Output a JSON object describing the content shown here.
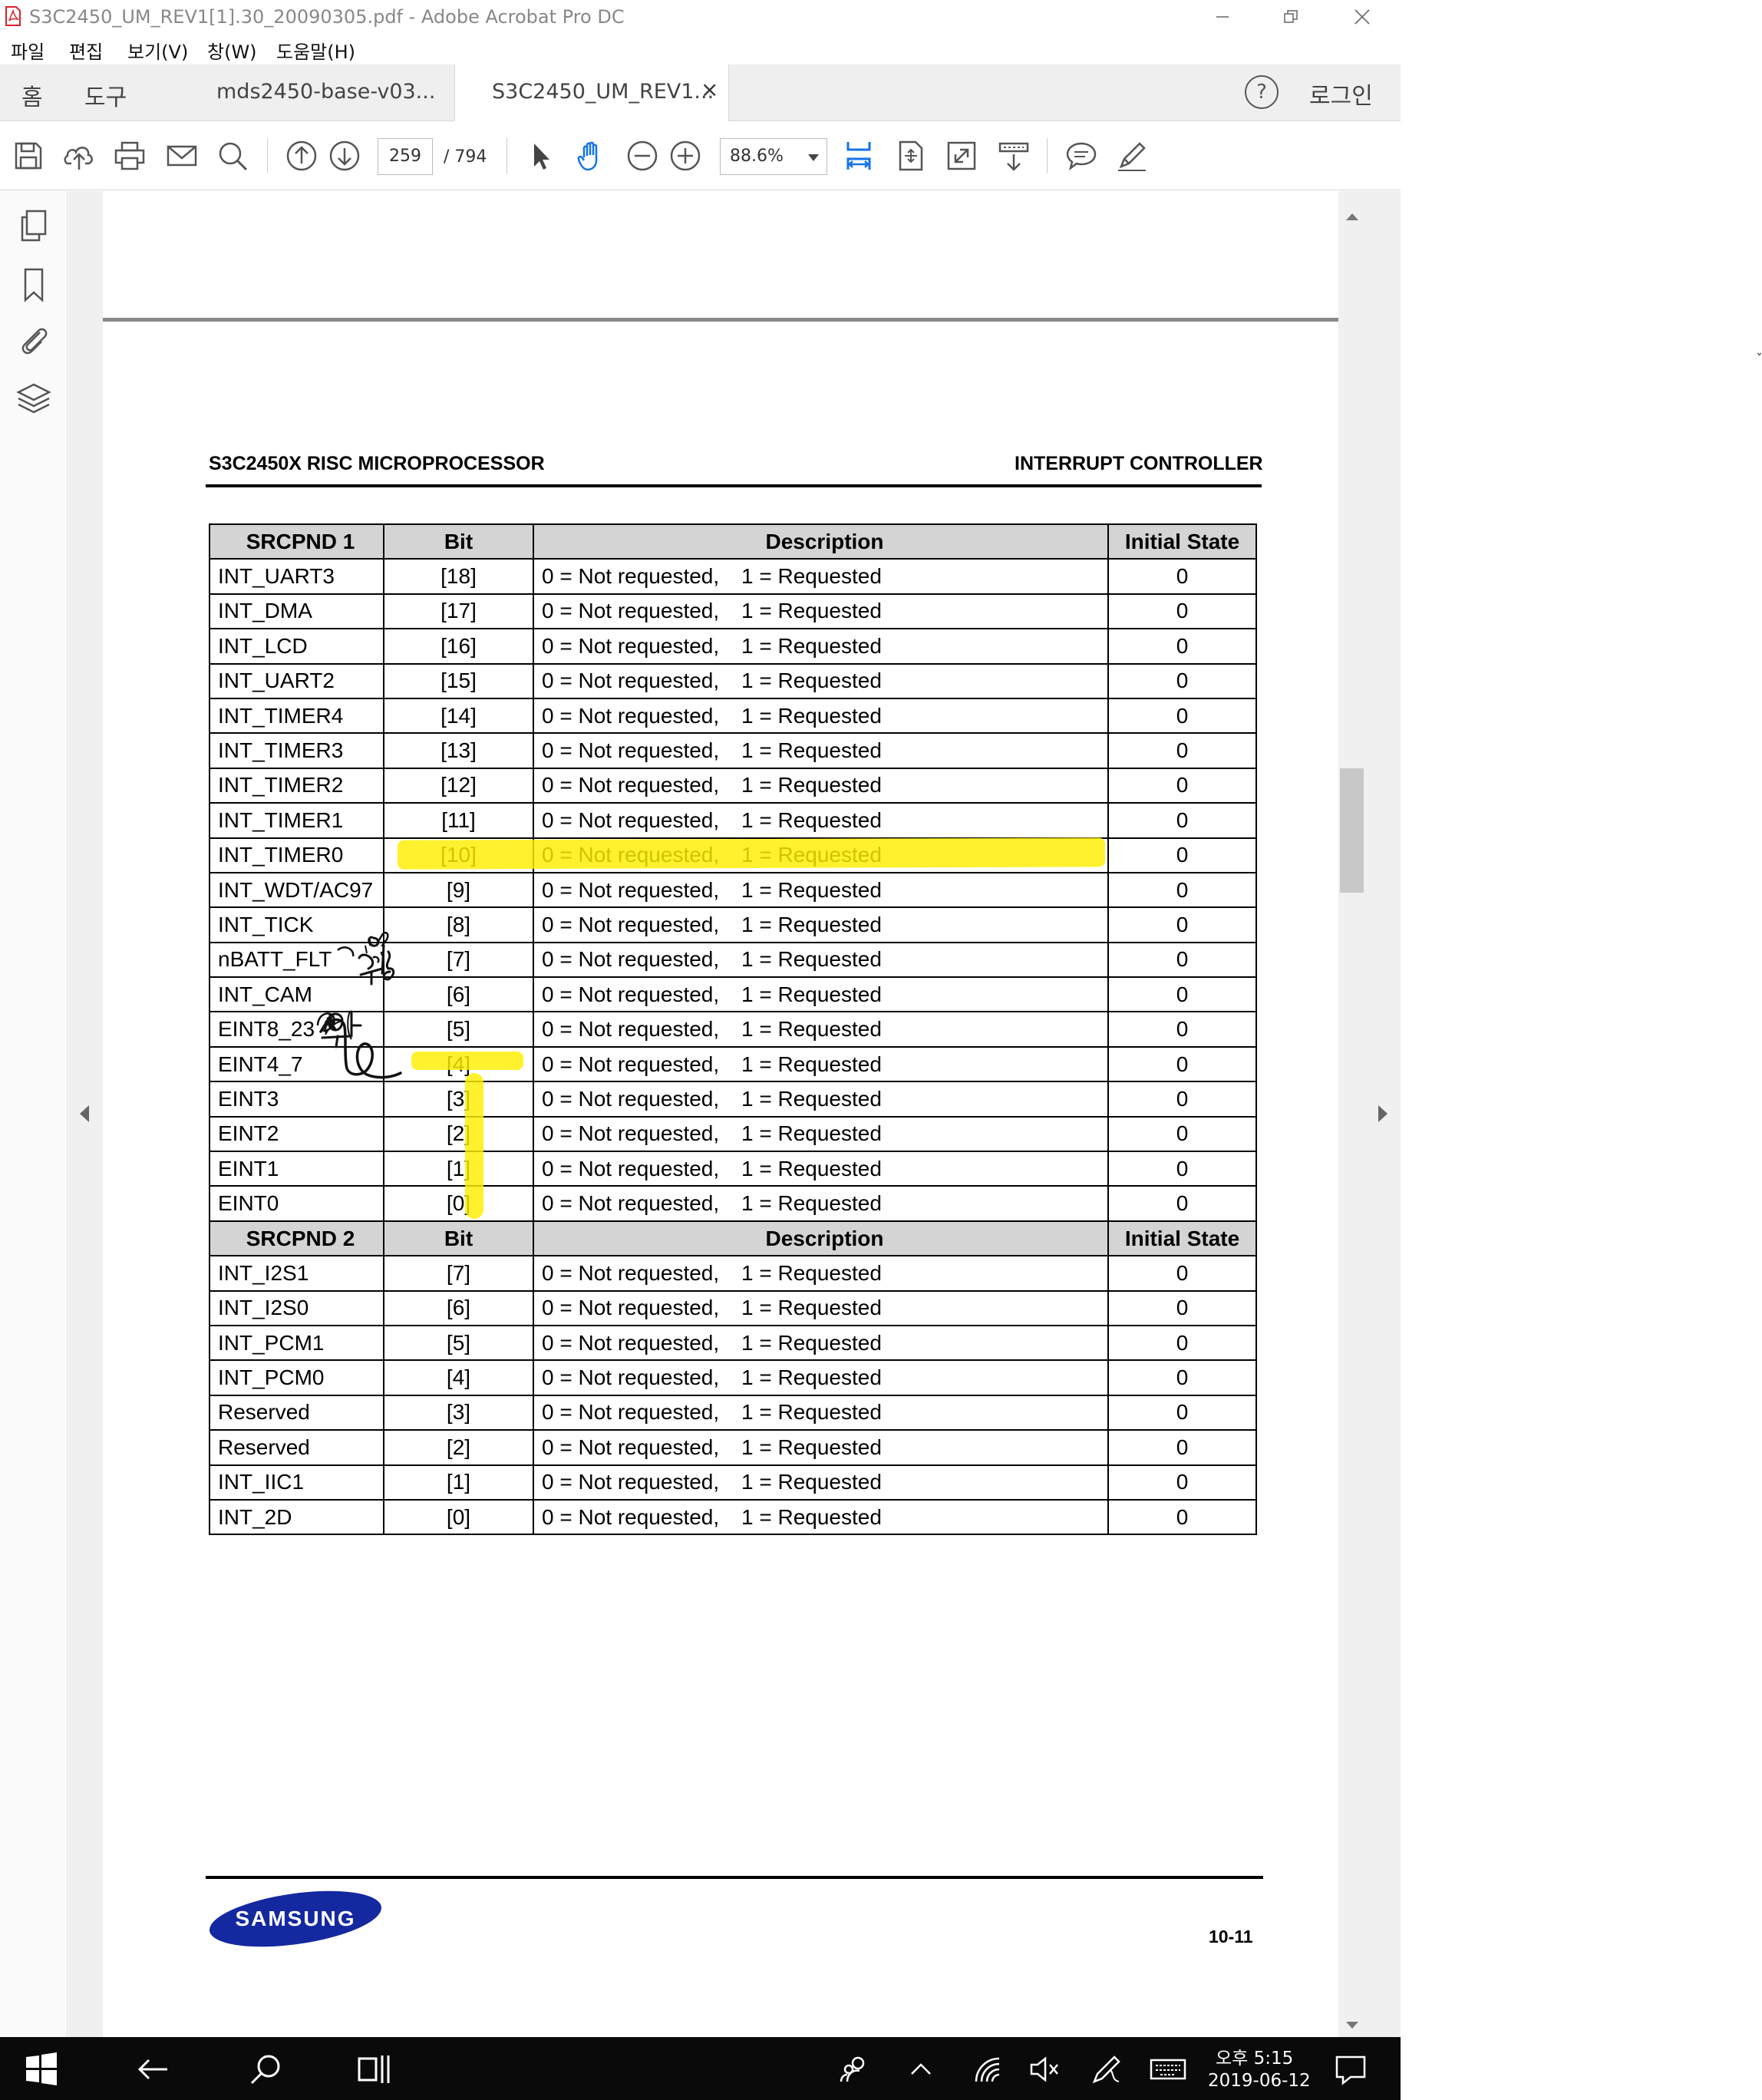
{
  "window": {
    "title": "S3C2450_UM_REV1[1].30_20090305.pdf - Adobe Acrobat Pro DC"
  },
  "menu": [
    "파일",
    "편집",
    "보기(V)",
    "창(W)",
    "도움말(H)"
  ],
  "tabs": {
    "home": "홈",
    "tools": "도구",
    "doc1": "mds2450-base-v03...",
    "doc2": "S3C2450_UM_REV1...",
    "close_glyph": "×",
    "help_glyph": "?",
    "login": "로그인"
  },
  "toolbar": {
    "page_current": "259",
    "page_total": "/ 794",
    "zoom": "88.6%"
  },
  "document": {
    "header_left": "S3C2450X RISC MICROPROCESSOR",
    "header_right": "INTERRUPT CONTROLLER",
    "page_number": "10-11",
    "logo_text": "SAMSUNG",
    "desc_zero": "0 = Not requested,",
    "desc_one": "1 = Requested",
    "table1": {
      "headers": [
        "SRCPND 1",
        "Bit",
        "Description",
        "Initial State"
      ],
      "rows": [
        {
          "name": "INT_UART3",
          "bit": "[18]",
          "init": "0"
        },
        {
          "name": "INT_DMA",
          "bit": "[17]",
          "init": "0"
        },
        {
          "name": "INT_LCD",
          "bit": "[16]",
          "init": "0"
        },
        {
          "name": "INT_UART2",
          "bit": "[15]",
          "init": "0"
        },
        {
          "name": "INT_TIMER4",
          "bit": "[14]",
          "init": "0"
        },
        {
          "name": "INT_TIMER3",
          "bit": "[13]",
          "init": "0"
        },
        {
          "name": "INT_TIMER2",
          "bit": "[12]",
          "init": "0"
        },
        {
          "name": "INT_TIMER1",
          "bit": "[11]",
          "init": "0"
        },
        {
          "name": "INT_TIMER0",
          "bit": "[10]",
          "init": "0"
        },
        {
          "name": "INT_WDT/AC97",
          "bit": "[9]",
          "init": "0"
        },
        {
          "name": "INT_TICK",
          "bit": "[8]",
          "init": "0"
        },
        {
          "name": "nBATT_FLT",
          "bit": "[7]",
          "init": "0"
        },
        {
          "name": "INT_CAM",
          "bit": "[6]",
          "init": "0"
        },
        {
          "name": "EINT8_23",
          "bit": "[5]",
          "init": "0"
        },
        {
          "name": "EINT4_7",
          "bit": "[4]",
          "init": "0"
        },
        {
          "name": "EINT3",
          "bit": "[3]",
          "init": "0"
        },
        {
          "name": "EINT2",
          "bit": "[2]",
          "init": "0"
        },
        {
          "name": "EINT1",
          "bit": "[1]",
          "init": "0"
        },
        {
          "name": "EINT0",
          "bit": "[0]",
          "init": "0"
        }
      ]
    },
    "table2": {
      "headers": [
        "SRCPND 2",
        "Bit",
        "Description",
        "Initial State"
      ],
      "rows": [
        {
          "name": "INT_I2S1",
          "bit": "[7]",
          "init": "0"
        },
        {
          "name": "INT_I2S0",
          "bit": "[6]",
          "init": "0"
        },
        {
          "name": "INT_PCM1",
          "bit": "[5]",
          "init": "0"
        },
        {
          "name": "INT_PCM0",
          "bit": "[4]",
          "init": "0"
        },
        {
          "name": "Reserved",
          "bit": "[3]",
          "init": "0"
        },
        {
          "name": "Reserved",
          "bit": "[2]",
          "init": "0"
        },
        {
          "name": "INT_IIC1",
          "bit": "[1]",
          "init": "0"
        },
        {
          "name": "INT_2D",
          "bit": "[0]",
          "init": "0"
        }
      ]
    },
    "handwriting": "오버뭐징?"
  },
  "taskbar": {
    "time": "오후 5:15",
    "date": "2019-06-12"
  },
  "stray_glyph": "ˇ",
  "colors": {
    "highlight": "#ffee00",
    "acrobat_blue": "#1473e6",
    "acrobat_red": "#d9222a",
    "samsung_blue": "#1428a0"
  },
  "icons": {
    "toolbar": [
      "save-icon",
      "upload-icon",
      "print-icon",
      "mail-icon",
      "search-icon",
      "page-up-icon",
      "page-down-icon",
      "select-arrow-icon",
      "hand-icon",
      "zoom-out-icon",
      "zoom-in-icon",
      "fit-width-icon",
      "fit-page-icon",
      "full-screen-icon",
      "scroll-mode-icon",
      "comment-icon",
      "highlight-pen-icon"
    ],
    "nav": [
      "pages-icon",
      "bookmark-icon",
      "attachment-icon",
      "layers-icon"
    ],
    "taskbar": [
      "windows-start-icon",
      "back-arrow-icon",
      "search-icon",
      "task-view-icon",
      "people-icon",
      "tray-up-icon",
      "wifi-icon",
      "volume-muted-icon",
      "pen-icon",
      "keyboard-icon",
      "notification-icon"
    ]
  }
}
